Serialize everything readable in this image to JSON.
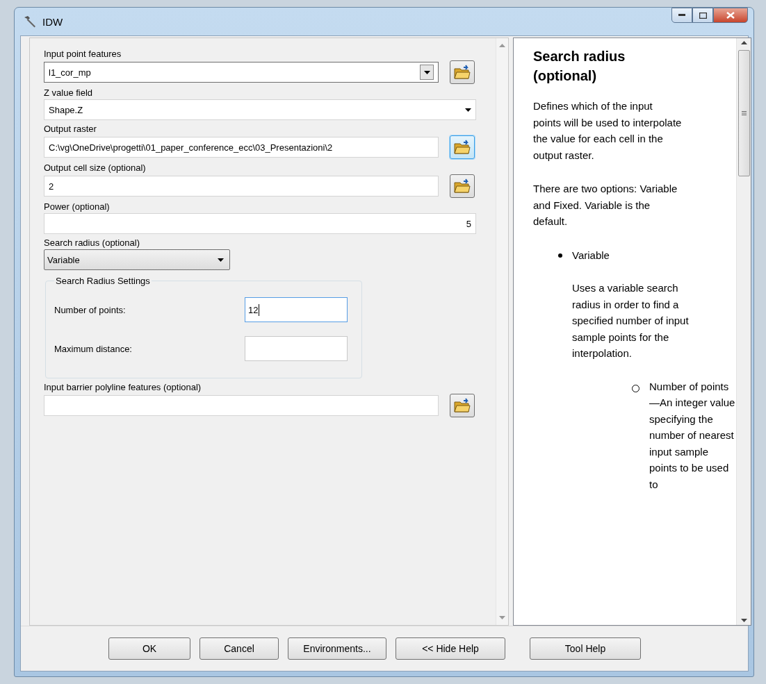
{
  "window": {
    "title": "IDW"
  },
  "fields": [
    {
      "kind": "combo",
      "label": "Input point features",
      "value": "l1_cor_mp",
      "browse": true,
      "browse_focused": false
    },
    {
      "kind": "dropdown",
      "label": "Z value field",
      "value": "Shape.Z"
    },
    {
      "kind": "text",
      "label": "Output raster",
      "value": "C:\\vg\\OneDrive\\progetti\\01_paper_conference_ecc\\03_Presentazioni\\2",
      "browse": true,
      "browse_focused": true
    },
    {
      "kind": "text",
      "label": "Output cell size (optional)",
      "value": "2",
      "browse": true,
      "browse_focused": false
    },
    {
      "kind": "number",
      "label": "Power (optional)",
      "value": "5"
    },
    {
      "kind": "select",
      "label": "Search radius (optional)",
      "value": "Variable"
    },
    {
      "kind": "group",
      "label": "Search Radius Settings",
      "rows": [
        {
          "label": "Number of points:",
          "value": "12",
          "focused": true
        },
        {
          "label": "Maximum distance:",
          "focused": false
        }
      ]
    },
    {
      "kind": "text",
      "label": "Input barrier polyline features (optional)",
      "browse": true,
      "browse_focused": false
    }
  ],
  "help": {
    "title": "Search radius (optional)",
    "paragraphs": [
      "Defines which of the input points will be used to interpolate the value for each cell in the output raster.",
      "There are two options: Variable and Fixed. Variable is the default."
    ],
    "items": [
      {
        "text": "Variable",
        "body": "Uses a variable search radius in order to find a specified number of input sample points for the interpolation.",
        "children": [
          {
            "text": "Number of points—An integer value specifying the number of nearest input sample points to be used to"
          }
        ]
      }
    ]
  },
  "buttons": [
    "OK",
    "Cancel",
    "Environments...",
    "<< Hide Help",
    "Tool Help"
  ]
}
